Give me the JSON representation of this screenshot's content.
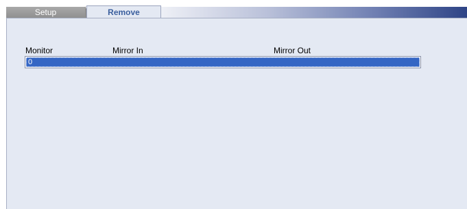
{
  "tabs": {
    "setup_label": "Setup",
    "remove_label": "Remove",
    "active": "Remove"
  },
  "table": {
    "columns": [
      "Monitor",
      "Mirror In",
      "Mirror Out"
    ],
    "rows": [
      {
        "monitor": "0",
        "mirror_in": "",
        "mirror_out": "",
        "selected": true
      }
    ]
  },
  "colors": {
    "panel_background": "#e4e9f3",
    "selected_row": "#3566c4",
    "active_tab_text": "#3b5f9e",
    "tab_strip_dark": "#2e4486"
  }
}
